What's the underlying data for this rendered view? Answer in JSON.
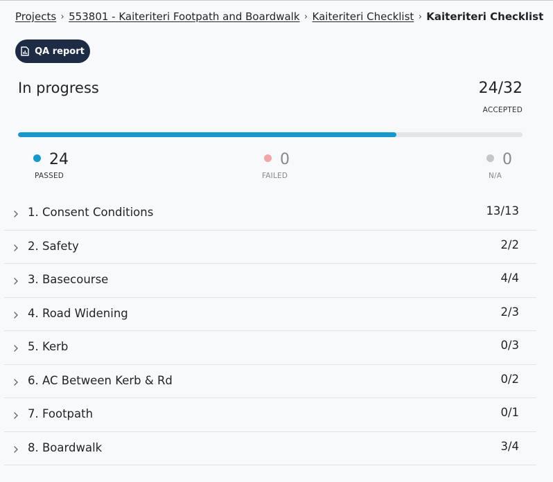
{
  "breadcrumb": {
    "items": [
      "Projects",
      "553801 - Kaiteriteri Footpath and Boardwalk",
      "Kaiteriteri Checklist"
    ],
    "current": "Kaiteriteri Checklist"
  },
  "actions": {
    "qa_report_label": "QA report",
    "qa_report_icon": "report-chart-icon"
  },
  "summary": {
    "status": "In progress",
    "accepted_count": "24/32",
    "accepted_label": "ACCEPTED",
    "progress_fraction": 0.75
  },
  "stats": [
    {
      "value": "24",
      "label": "PASSED",
      "color": "#1098d4",
      "value_color": "#1f2328",
      "label_color": "#333333"
    },
    {
      "value": "0",
      "label": "FAILED",
      "color": "#f4a3a6",
      "value_color": "#888888",
      "label_color": "#888888"
    },
    {
      "value": "0",
      "label": "N/A",
      "color": "#c4c6c9",
      "value_color": "#888888",
      "label_color": "#888888"
    }
  ],
  "sections": [
    {
      "name": "1. Consent Conditions",
      "progress": "13/13"
    },
    {
      "name": "2. Safety",
      "progress": "2/2"
    },
    {
      "name": "3. Basecourse",
      "progress": "4/4"
    },
    {
      "name": "4. Road Widening",
      "progress": "2/3"
    },
    {
      "name": "5. Kerb",
      "progress": "0/3"
    },
    {
      "name": "6. AC Between Kerb & Rd",
      "progress": "0/2"
    },
    {
      "name": "7. Footpath",
      "progress": "0/1"
    },
    {
      "name": "8. Boardwalk",
      "progress": "3/4"
    }
  ],
  "colors": {
    "accent": "#0f9ad6",
    "button_bg": "#1d2b45"
  }
}
